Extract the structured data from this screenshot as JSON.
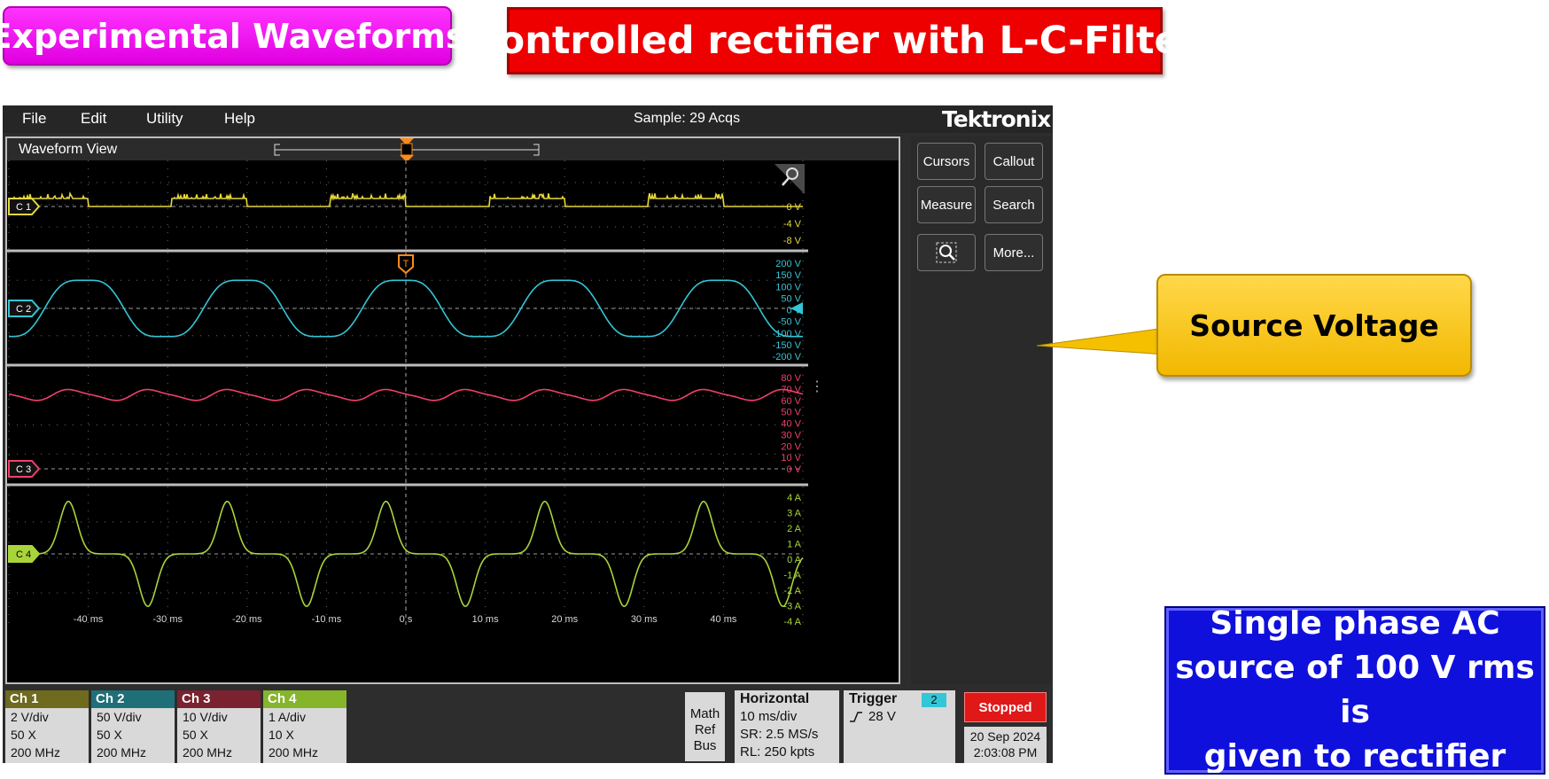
{
  "banners": {
    "experimental": "Experimental Waveforms",
    "title": "Controlled rectifier with L-C-Filter"
  },
  "menu": {
    "file": "File",
    "edit": "Edit",
    "utility": "Utility",
    "help": "Help"
  },
  "status": {
    "sample": "Sample: 29 Acqs"
  },
  "brand": "Tektronix",
  "waveform_view": {
    "title": "Waveform View",
    "trigger_marker": "T"
  },
  "channels": [
    {
      "id": "C 1",
      "color": "#e6d73a",
      "labels": [
        "0 V",
        "-4 V",
        "-8 V"
      ]
    },
    {
      "id": "C 2",
      "color": "#33c6d6",
      "labels": [
        "200 V",
        "150 V",
        "100 V",
        "50 V",
        "0 V",
        "-50 V",
        "-100 V",
        "-150 V",
        "-200 V"
      ]
    },
    {
      "id": "C 3",
      "color": "#f0406a",
      "labels": [
        "80 V",
        "70 V",
        "60 V",
        "50 V",
        "40 V",
        "30 V",
        "20 V",
        "10 V",
        "0 V"
      ]
    },
    {
      "id": "C 4",
      "color": "#a8d43a",
      "labels": [
        "4 A",
        "3 A",
        "2 A",
        "1 A",
        "0 A",
        "-1 A",
        "-2 A",
        "-3 A",
        "-4 A"
      ]
    }
  ],
  "time_axis": [
    "-40 ms",
    "-30 ms",
    "-20 ms",
    "-10 ms",
    "0 s",
    "10 ms",
    "20 ms",
    "30 ms",
    "40 ms"
  ],
  "side_buttons": {
    "cursors": "Cursors",
    "callout": "Callout",
    "measure": "Measure",
    "search": "Search",
    "more": "More..."
  },
  "channel_badges": [
    {
      "name": "Ch 1",
      "color": "#6e6a1e",
      "vdiv": "2 V/div",
      "atten": "50 X",
      "bw": "200 MHz"
    },
    {
      "name": "Ch 2",
      "color": "#1f6f78",
      "vdiv": "50 V/div",
      "atten": "50 X",
      "bw": "200 MHz"
    },
    {
      "name": "Ch 3",
      "color": "#7a2230",
      "vdiv": "10 V/div",
      "atten": "50 X",
      "bw": "200 MHz"
    },
    {
      "name": "Ch 4",
      "color": "#86b52b",
      "vdiv": "1 A/div",
      "atten": "10 X",
      "bw": "200 MHz"
    }
  ],
  "math_ref_bus": {
    "line1": "Math",
    "line2": "Ref",
    "line3": "Bus"
  },
  "horizontal": {
    "title": "Horizontal",
    "scale": "10 ms/div",
    "sr": "SR: 2.5 MS/s",
    "rl": "RL: 250 kpts"
  },
  "trigger": {
    "title": "Trigger",
    "channel": "2",
    "level": "28 V"
  },
  "run_state": "Stopped",
  "datetime": {
    "date": "20 Sep 2024",
    "time": "2:03:08 PM"
  },
  "callout": {
    "text": "Source Voltage"
  },
  "info_box": {
    "line1": "Single phase AC",
    "line2": "source of 100 V rms is",
    "line3": "given to rectifier"
  },
  "colors": {
    "callout_fill": "#f5c000",
    "info_fill": "#1010dd",
    "banner_red": "#ee0000",
    "banner_magenta": "#f020f0"
  }
}
